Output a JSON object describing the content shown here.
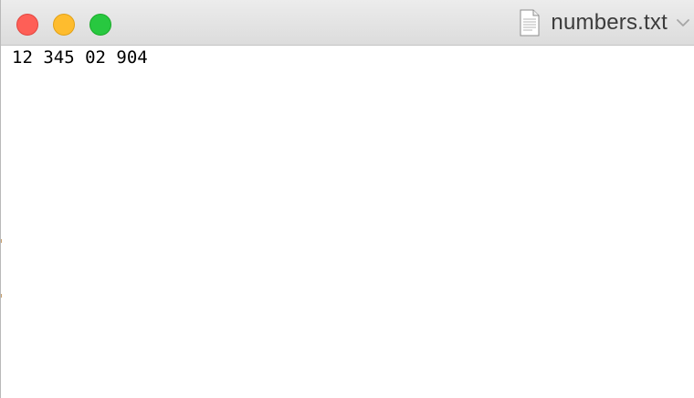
{
  "window": {
    "title": "numbers.txt",
    "icons": {
      "close": "close-traffic-light",
      "minimize": "minimize-traffic-light",
      "zoom": "zoom-traffic-light",
      "document": "text-document-icon",
      "chevron": "chevron-down-icon"
    },
    "colors": {
      "close": "#fe5f57",
      "minimize": "#febc2e",
      "zoom": "#28c840",
      "titlebar": "#e3e3e3",
      "text": "#000000"
    }
  },
  "editor": {
    "content": "12 345 02 904"
  }
}
